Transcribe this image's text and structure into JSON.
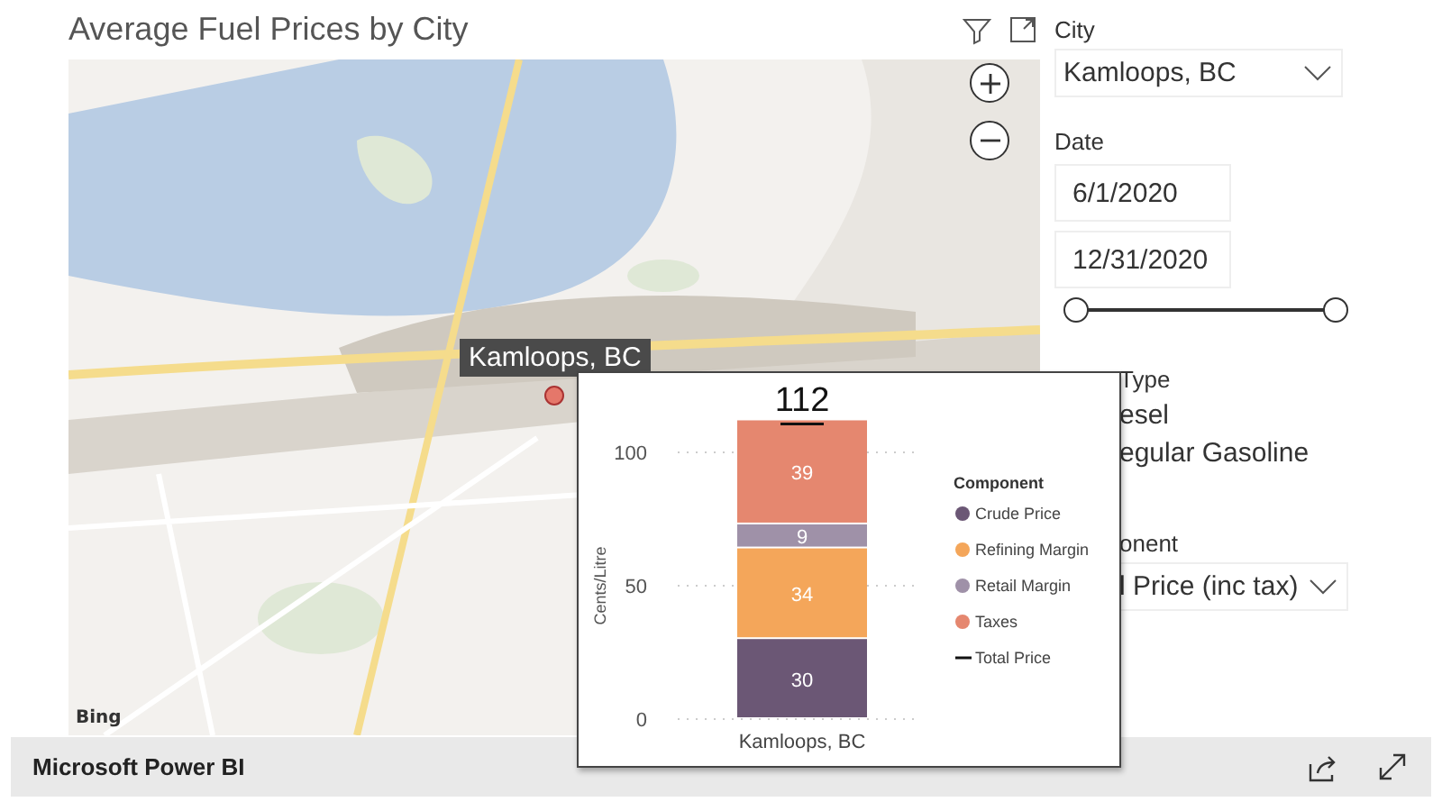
{
  "visual": {
    "title": "Average Fuel Prices by City"
  },
  "map": {
    "pin_label": "Kamloops, BC",
    "attribution": "Bing"
  },
  "slicers": {
    "city": {
      "label": "City",
      "value": "Kamloops, BC"
    },
    "date": {
      "label": "Date",
      "start": "6/1/2020",
      "end": "12/31/2020",
      "handles": [
        {
          "level": 0
        },
        {
          "level": 1
        }
      ]
    },
    "type": {
      "label": "Type",
      "items": [
        "esel",
        "egular Gasoline"
      ]
    },
    "component": {
      "label": "onent",
      "value": "l Price (inc tax)"
    }
  },
  "tooltip": {
    "chart_data": {
      "type": "bar",
      "ylabel": "Cents/Litre",
      "categories": [
        "Kamloops, BC"
      ],
      "stacked": true,
      "data_labels": true,
      "ylim": [
        0,
        112
      ],
      "yticks": [
        0,
        50,
        100
      ],
      "legend": {
        "title": "Component"
      },
      "series": [
        {
          "name": "Crude Price",
          "color": "#6b5775",
          "values": [
            30
          ]
        },
        {
          "name": "Refining Margin",
          "color": "#f4a65a",
          "values": [
            34
          ]
        },
        {
          "name": "Retail Margin",
          "color": "#9f91a8",
          "values": [
            9
          ]
        },
        {
          "name": "Taxes",
          "color": "#e5876f",
          "values": [
            39
          ]
        }
      ],
      "annotations": [
        {
          "y": 112,
          "text": "112"
        }
      ]
    },
    "legend_line_label": "Total Price"
  },
  "footer": {
    "brand": "Microsoft Power BI"
  }
}
